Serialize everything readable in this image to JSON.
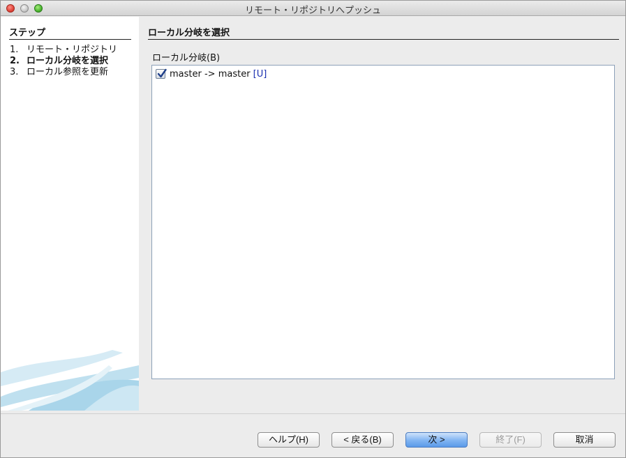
{
  "window": {
    "title": "リモート・リポジトリへプッシュ"
  },
  "sidebar": {
    "heading": "ステップ",
    "steps": [
      {
        "num": "1.",
        "label": "リモート・リポジトリ"
      },
      {
        "num": "2.",
        "label": "ローカル分岐を選択"
      },
      {
        "num": "3.",
        "label": "ローカル参照を更新"
      }
    ],
    "current_step": 2
  },
  "main": {
    "heading": "ローカル分岐を選択",
    "list_label": "ローカル分岐(B)",
    "items": [
      {
        "text": "master -> master ",
        "tag": "[U]",
        "checked": true
      }
    ]
  },
  "buttons": {
    "help": "ヘルプ(H)",
    "back": "< 戻る(B)",
    "next": "次 >",
    "finish": "終了(F)",
    "cancel": "取消"
  },
  "colors": {
    "primary_button": "#7fb3f2",
    "tag_text": "#1a2fb0"
  }
}
